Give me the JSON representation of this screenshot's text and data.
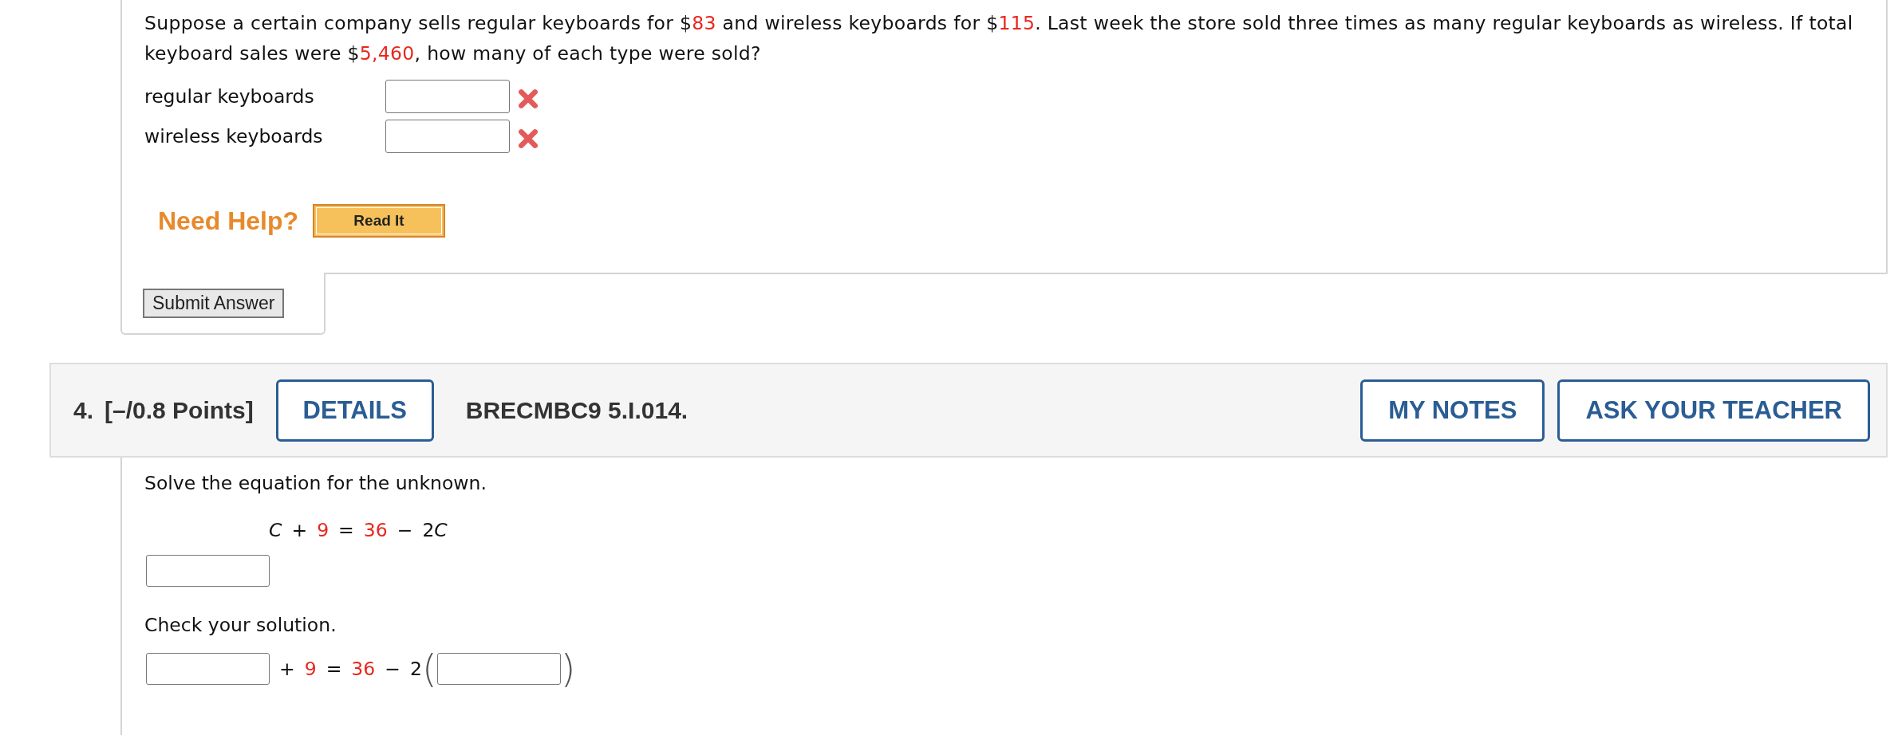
{
  "question_3": {
    "prompt": [
      {
        "kind": "text",
        "text": "Suppose a certain company sells regular keyboards for $"
      },
      {
        "kind": "num",
        "text": "83"
      },
      {
        "kind": "text",
        "text": " and wireless keyboards for $"
      },
      {
        "kind": "num",
        "text": "115"
      },
      {
        "kind": "text",
        "text": ". Last week the store sold three times as many regular keyboards as wireless. If total keyboard sales were $"
      },
      {
        "kind": "num",
        "text": "5,460"
      },
      {
        "kind": "text",
        "text": ", how many of each type were sold?"
      }
    ],
    "answers": [
      {
        "label": "regular keyboards",
        "incorrect": true
      },
      {
        "label": "wireless keyboards",
        "incorrect": true
      }
    ],
    "help": {
      "label": "Need Help?",
      "buttons": [
        "Read It"
      ]
    },
    "submit": "Submit Answer"
  },
  "question_4": {
    "number": "4.",
    "points": "[–/0.8 Points]",
    "details": "DETAILS",
    "code": "BRECMBC9 5.I.014.",
    "actions": [
      "MY NOTES",
      "ASK YOUR TEACHER"
    ],
    "instruction": "Solve the equation for the unknown.",
    "equation": [
      {
        "kind": "var",
        "text": "C"
      },
      {
        "kind": "op",
        "text": "+"
      },
      {
        "kind": "num",
        "text": "9"
      },
      {
        "kind": "op",
        "text": "="
      },
      {
        "kind": "num",
        "text": "36"
      },
      {
        "kind": "op",
        "text": "−"
      },
      {
        "kind": "text",
        "text": "2"
      },
      {
        "kind": "var",
        "text": "C"
      }
    ],
    "check_label": "Check your solution.",
    "check_equation": [
      {
        "kind": "field"
      },
      {
        "kind": "op",
        "text": "+"
      },
      {
        "kind": "num",
        "text": "9"
      },
      {
        "kind": "op",
        "text": "="
      },
      {
        "kind": "num",
        "text": "36"
      },
      {
        "kind": "op",
        "text": "−"
      },
      {
        "kind": "text",
        "text": "2"
      },
      {
        "kind": "paren",
        "text": "("
      },
      {
        "kind": "field"
      },
      {
        "kind": "paren",
        "text": ")"
      }
    ]
  }
}
